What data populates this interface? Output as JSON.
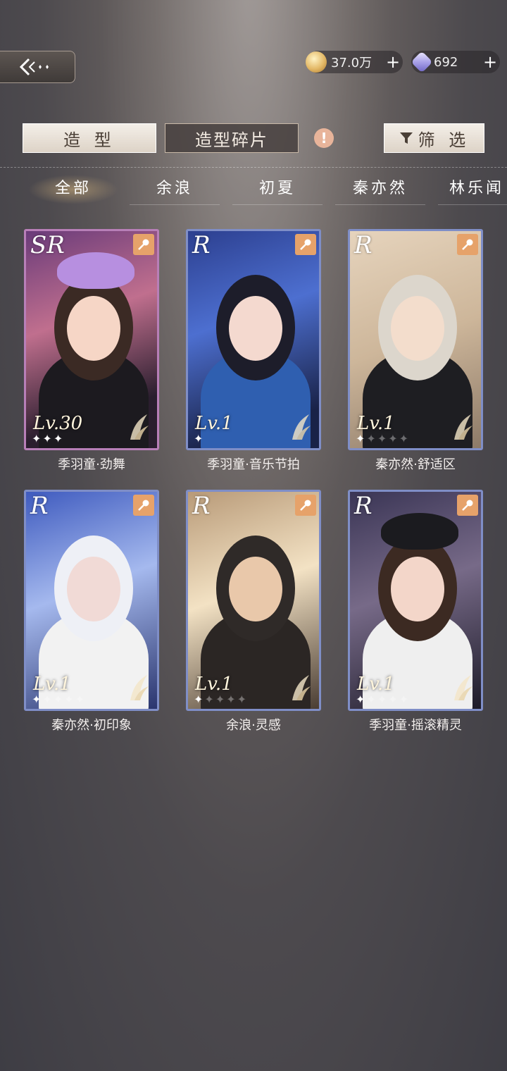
{
  "currencies": {
    "gold": {
      "icon": "gold-coin-icon",
      "value": "37.0万"
    },
    "gem": {
      "icon": "diamond-icon",
      "value": "692"
    }
  },
  "top_buttons": {
    "outfit": "造 型",
    "shards": "造型碎片",
    "filter": "筛 选"
  },
  "tabs": [
    {
      "label": "全部",
      "active": true
    },
    {
      "label": "余浪",
      "active": false
    },
    {
      "label": "初夏",
      "active": false
    },
    {
      "label": "秦亦然",
      "active": false
    },
    {
      "label": "林乐闻",
      "active": false
    }
  ],
  "cards": [
    {
      "rarity": "SR",
      "level": "Lv.30",
      "stars_filled": 3,
      "stars_total": 3,
      "name": "季羽童·劲舞"
    },
    {
      "rarity": "R",
      "level": "Lv.1",
      "stars_filled": 1,
      "stars_total": 1,
      "name": "季羽童·音乐节拍"
    },
    {
      "rarity": "R",
      "level": "Lv.1",
      "stars_filled": 1,
      "stars_total": 5,
      "name": "秦亦然·舒适区"
    },
    {
      "rarity": "R",
      "level": "Lv.1",
      "stars_filled": 1,
      "stars_total": 5,
      "name": "秦亦然·初印象"
    },
    {
      "rarity": "R",
      "level": "Lv.1",
      "stars_filled": 1,
      "stars_total": 5,
      "name": "余浪·灵感"
    },
    {
      "rarity": "R",
      "level": "Lv.1",
      "stars_filled": 1,
      "stars_total": 5,
      "name": "季羽童·摇滚精灵"
    }
  ],
  "colors": {
    "accent_beige": "#ddd3c7",
    "sr_border": "#b87fb8",
    "r_border": "#7f8ec7",
    "mic_badge": "#e6a26a",
    "alert": "#e8b49a"
  }
}
